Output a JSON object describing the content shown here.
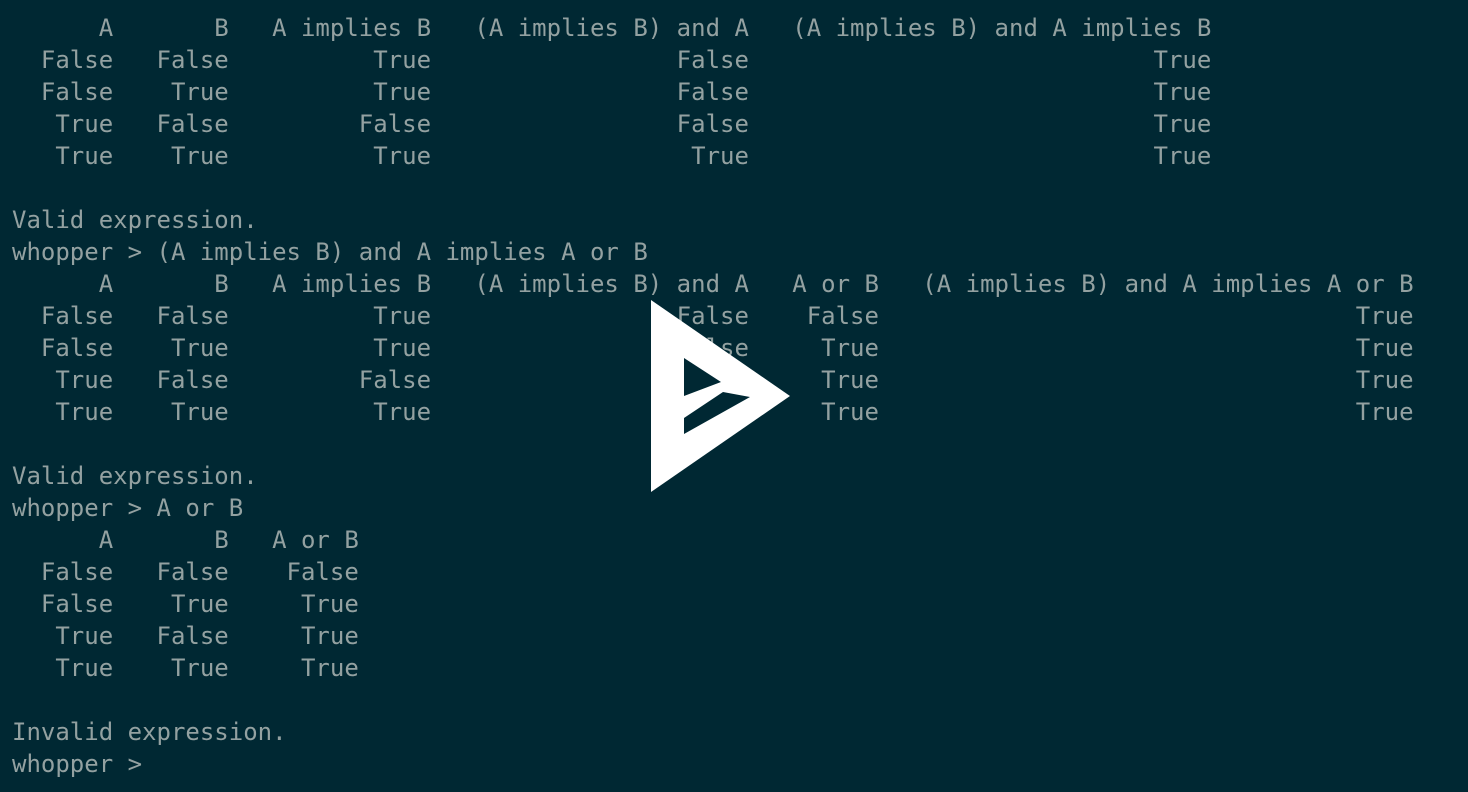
{
  "terminal": {
    "prompt": "whopper > ",
    "lines": [
      "      A       B   A implies B   (A implies B) and A   (A implies B) and A implies B",
      "  False   False          True                 False                            True",
      "  False    True          True                 False                            True",
      "   True   False         False                 False                            True",
      "   True    True          True                  True                            True",
      "",
      "Valid expression.",
      "whopper > (A implies B) and A implies A or B",
      "      A       B   A implies B   (A implies B) and A   A or B   (A implies B) and A implies A or B",
      "  False   False          True                 False    False                                 True",
      "  False    True          True                 False     True                                 True",
      "   True   False         False                 False     True                                 True",
      "   True    True          True                  True     True                                 True",
      "",
      "Valid expression.",
      "whopper > A or B",
      "      A       B   A or B",
      "  False   False    False",
      "  False    True     True",
      "   True   False     True",
      "   True    True     True",
      "",
      "Invalid expression.",
      "whopper > "
    ]
  },
  "overlay": {
    "icon": "asciinema-play-icon",
    "color": "#ffffff"
  },
  "colors": {
    "background": "#002833",
    "text": "#93a1a1"
  }
}
